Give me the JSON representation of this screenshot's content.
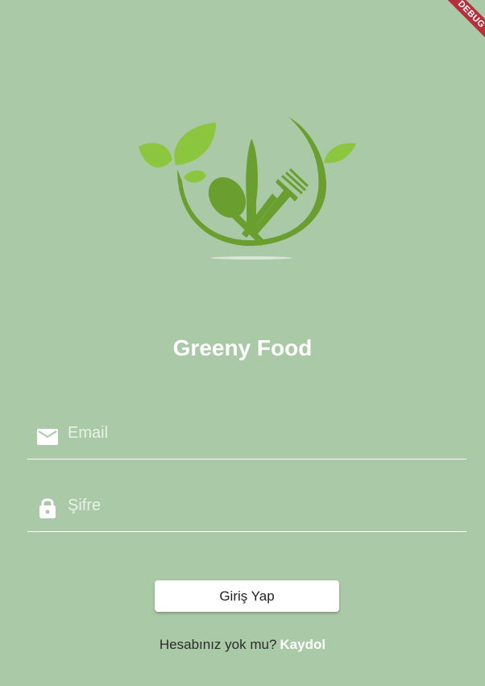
{
  "debug_banner": "DEBUG",
  "brand": {
    "title": "Greeny Food"
  },
  "email_field": {
    "icon": "mail-icon",
    "placeholder": "Email"
  },
  "password_field": {
    "icon": "lock-icon",
    "placeholder": "Şifre"
  },
  "login_button": {
    "label": "Giriş Yap"
  },
  "signup": {
    "question": "Hesabınız yok mu?",
    "link": "Kaydol"
  },
  "colors": {
    "background": "#aac9a7",
    "logo_green_dark": "#6a9f2f",
    "logo_green_light": "#8cc63f",
    "debug_banner": "#b5303a"
  }
}
